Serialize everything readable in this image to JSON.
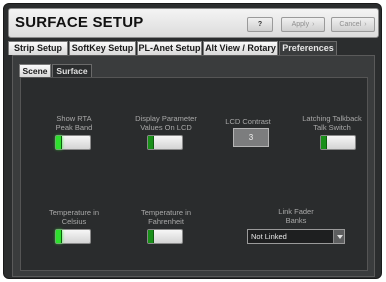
{
  "window": {
    "title": "SURFACE SETUP",
    "help_label": "?",
    "apply_label": "Apply",
    "cancel_label": "Cancel"
  },
  "tabs": [
    {
      "label": "Strip Setup",
      "active": false
    },
    {
      "label": "SoftKey Setup",
      "active": false
    },
    {
      "label": "PL-Anet Setup",
      "active": false
    },
    {
      "label": "Alt View / Rotary",
      "active": false
    },
    {
      "label": "Preferences",
      "active": true
    }
  ],
  "subtabs": [
    {
      "label": "Scene",
      "active": false
    },
    {
      "label": "Surface",
      "active": true
    }
  ],
  "controls": {
    "show_rta": {
      "label_line1": "Show RTA",
      "label_line2": "Peak Band",
      "on": true
    },
    "display_param": {
      "label_line1": "Display Parameter",
      "label_line2": "Values On LCD",
      "on": false
    },
    "lcd_contrast": {
      "label": "LCD Contrast",
      "value": "3"
    },
    "latching_talkback": {
      "label_line1": "Latching Talkback",
      "label_line2": "Talk Switch",
      "on": false
    },
    "temp_celsius": {
      "label_line1": "Temperature in",
      "label_line2": "Celsius",
      "on": true
    },
    "temp_fahrenheit": {
      "label_line1": "Temperature in",
      "label_line2": "Fahrenheit",
      "on": false
    },
    "link_fader_banks": {
      "label_line1": "Link Fader",
      "label_line2": "Banks",
      "value": "Not Linked"
    }
  },
  "colors": {
    "led_on": "#2ee02e",
    "led_off": "#1a8f1a",
    "panel_bg": "#2a2c2d"
  }
}
